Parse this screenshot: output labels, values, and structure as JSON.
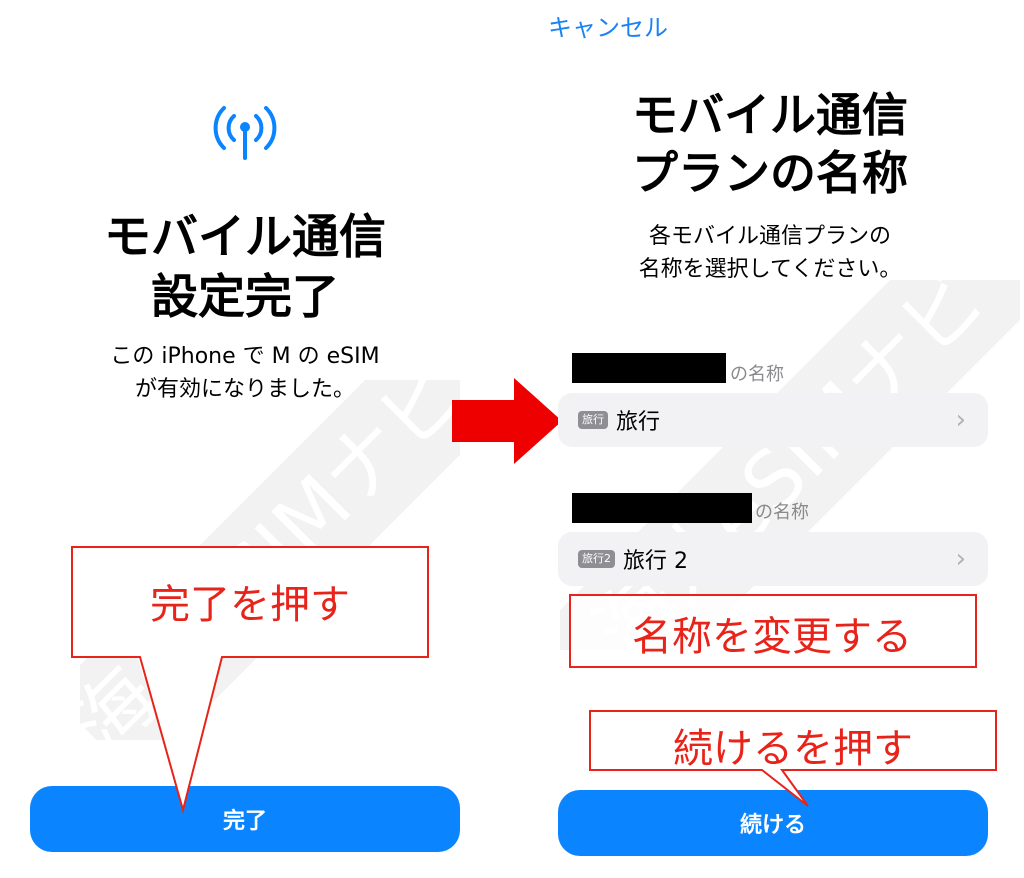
{
  "left_screen": {
    "title_line1": "モバイル通信",
    "title_line2": "設定完了",
    "subtitle_line1": "この iPhone で M の eSIM",
    "subtitle_line2": "が有効になりました。",
    "done_button": "完了",
    "icon": "cellular-antenna-icon"
  },
  "right_screen": {
    "cancel_label": "キャンセル",
    "title_line1": "モバイル通信",
    "title_line2": "プランの名称",
    "subtitle_line1": "各モバイル通信プランの",
    "subtitle_line2": "名称を選択してください。",
    "plans": [
      {
        "section_suffix": "の名称",
        "tag": "旅行",
        "label": "旅行"
      },
      {
        "section_suffix": "の名称",
        "tag": "旅行2",
        "label": "旅行 2"
      }
    ],
    "continue_button": "続ける"
  },
  "callouts": {
    "press_done": "完了を押す",
    "change_name": "名称を変更する",
    "press_continue": "続けるを押す"
  },
  "watermark": "海外eSIMナビ",
  "colors": {
    "accent_blue": "#0a84ff",
    "callout_red": "#e8231a",
    "arrow_red": "#ee0000"
  }
}
